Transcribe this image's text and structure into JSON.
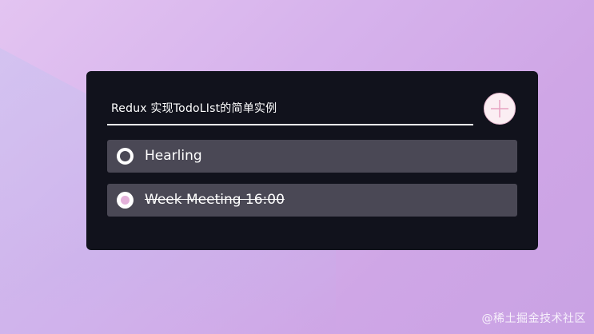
{
  "app": {
    "title": "Redux 实现TodoLIst的简单实例"
  },
  "add_button": {
    "icon": "plus-icon"
  },
  "todos": [
    {
      "text": "Hearling",
      "completed": false
    },
    {
      "text": "Week Meeting 16:00",
      "completed": true
    }
  ],
  "watermark": "@稀土掘金技术社区",
  "colors": {
    "card": "#11121c",
    "item": "#4a4855",
    "accent": "#e3b1da",
    "add_button": "#fbeef3"
  }
}
